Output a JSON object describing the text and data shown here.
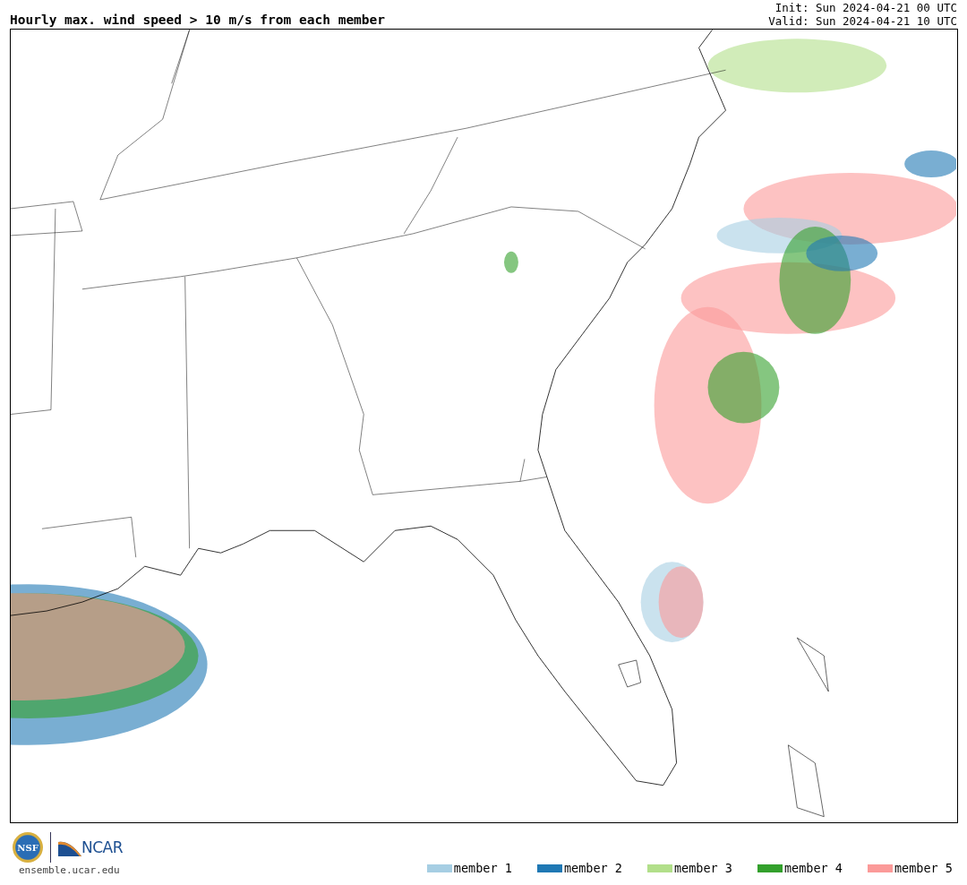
{
  "title": "Hourly max. wind speed > 10 m/s from each member",
  "run_info": {
    "init": "Init: Sun 2024-04-21 00 UTC",
    "valid": "Valid: Sun 2024-04-21 10 UTC"
  },
  "footer": {
    "logos": [
      {
        "text": "NSF"
      },
      {
        "text": "NCAR"
      }
    ],
    "site": "ensemble.ucar.edu"
  },
  "legend": [
    {
      "label": "member 1",
      "color": "#a6cee3"
    },
    {
      "label": "member 2",
      "color": "#1f78b4"
    },
    {
      "label": "member 3",
      "color": "#b2df8a"
    },
    {
      "label": "member 4",
      "color": "#33a02c"
    },
    {
      "label": "member 5",
      "color": "#fb9a99"
    }
  ]
}
